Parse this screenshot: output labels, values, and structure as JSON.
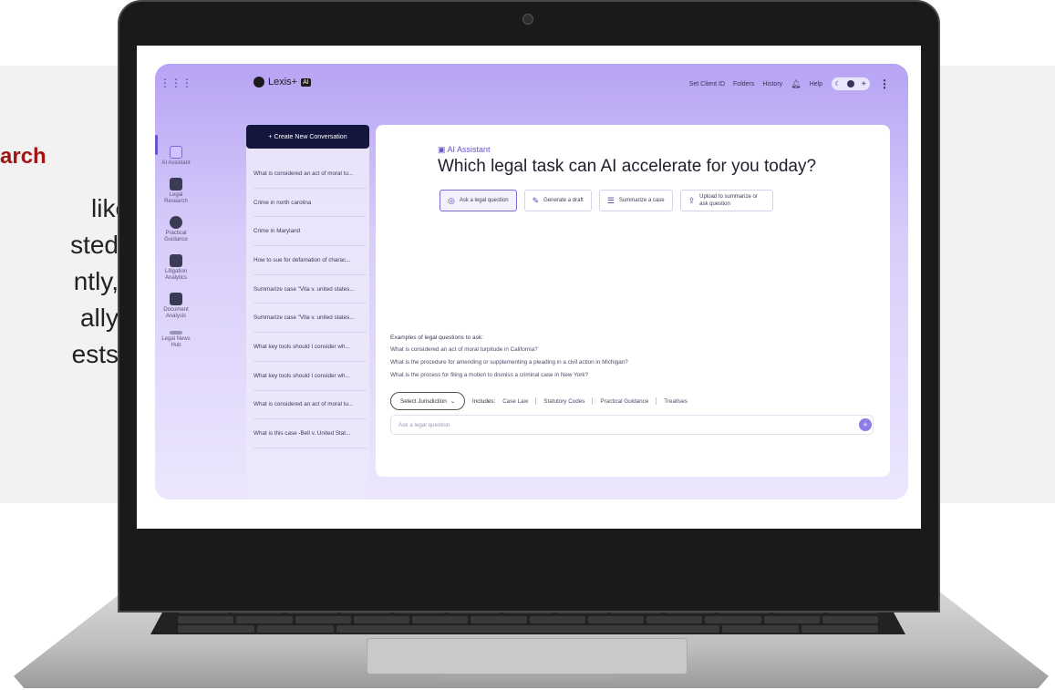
{
  "slide": {
    "heading": "arch",
    "lines": [
      "like",
      "sted",
      "ntly,",
      "ally",
      "ests"
    ],
    "heading_color": "#a31515"
  },
  "app": {
    "logo_icon": "lexis-dot-icon",
    "logo_text": "Lexis+",
    "logo_badge": "AI",
    "top_links": [
      "Set Client ID",
      "Folders",
      "History"
    ],
    "bell_icon": "bell-icon",
    "help": "Help",
    "toggle_icons": [
      "moon-icon",
      "sun-icon"
    ],
    "menu_icon": "kebab-icon",
    "rail": [
      {
        "label": "AI Assistant",
        "icon": "ai-assistant-icon",
        "active": true
      },
      {
        "label": "Legal Research",
        "icon": "legal-research-icon",
        "active": false
      },
      {
        "label": "Practical Guidance",
        "icon": "practical-guidance-icon",
        "active": false
      },
      {
        "label": "Litigation Analytics",
        "icon": "analytics-icon",
        "active": false
      },
      {
        "label": "Document Analysis",
        "icon": "document-icon",
        "active": false
      },
      {
        "label": "Legal News Hub",
        "icon": "news-icon",
        "active": false
      }
    ],
    "create_button": "+ Create New Conversation",
    "conversations": [
      "What is considered an act of moral tu...",
      "Crime in north carolina",
      "Crime in Maryland",
      "How to sue for defamation of charac...",
      "Summarize case \"Vita v. united states...",
      "Summarize case \"Vita v. united states...",
      "What key tools should I consider wh...",
      "What key tools should I consider wh...",
      "What is considered an act of moral tu...",
      "What is this case -Bell v. United Stat..."
    ],
    "main": {
      "assistant_label": "AI Assistant",
      "headline": "Which legal task can AI accelerate for you today?",
      "tasks": [
        {
          "label": "Ask a legal question",
          "icon": "chat-icon",
          "selected": true
        },
        {
          "label": "Generate a draft",
          "icon": "draft-icon",
          "selected": false
        },
        {
          "label": "Summarize a case",
          "icon": "list-icon",
          "selected": false
        },
        {
          "label": "Upload to summarize or ask question",
          "icon": "upload-icon",
          "selected": false
        }
      ],
      "examples_title": "Examples of legal questions to ask:",
      "examples": [
        "What is considered an act of moral turpitude in California?",
        "What is the procedure for amending or supplementing a pleading in a civil action in Michigan?",
        "What is the process for filing a motion to dismiss a criminal case in New York?"
      ],
      "jurisdiction_button": "Select Jurisdiction",
      "includes_label": "Includes:",
      "sources": [
        "Case Law",
        "Statutory Codes",
        "Practical Guidance",
        "Treatises"
      ],
      "ask_placeholder": "Ask a legal question",
      "send_icon": "send-icon"
    }
  }
}
